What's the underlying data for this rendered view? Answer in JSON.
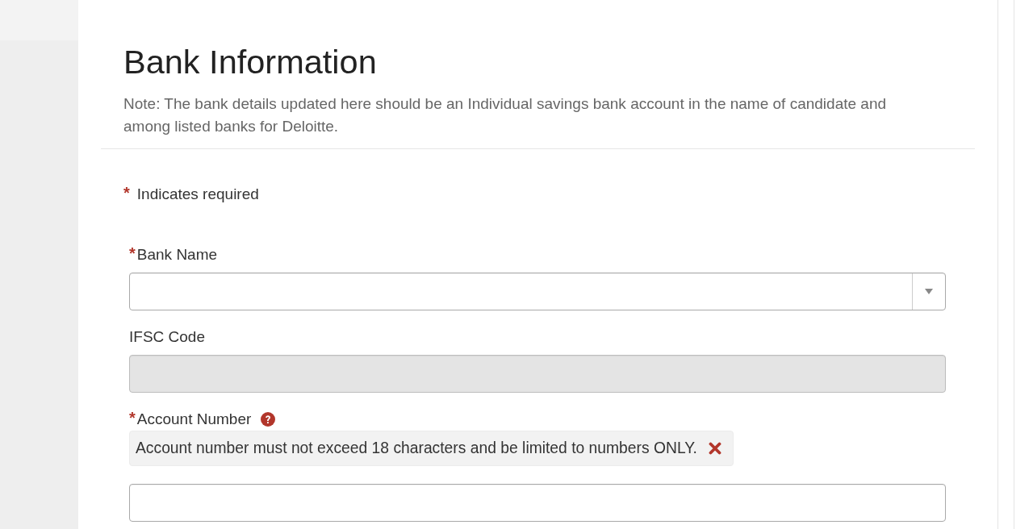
{
  "page": {
    "heading": "Bank Information",
    "note": "Note: The bank details updated here should be an Individual savings bank account in the name of candidate and among listed banks for Deloitte."
  },
  "required_legend": {
    "mark": "*",
    "text": "Indicates required"
  },
  "fields": [
    {
      "kind": "select",
      "required_mark": "*",
      "label": "Bank Name",
      "help": false,
      "disabled": false
    },
    {
      "kind": "text",
      "label": "IFSC Code",
      "help": false,
      "disabled": true
    },
    {
      "kind": "text",
      "required_mark": "*",
      "label": "Account Number",
      "help": true,
      "error": "Account number must not exceed 18 characters and be limited to numbers ONLY.",
      "disabled": false
    }
  ]
}
